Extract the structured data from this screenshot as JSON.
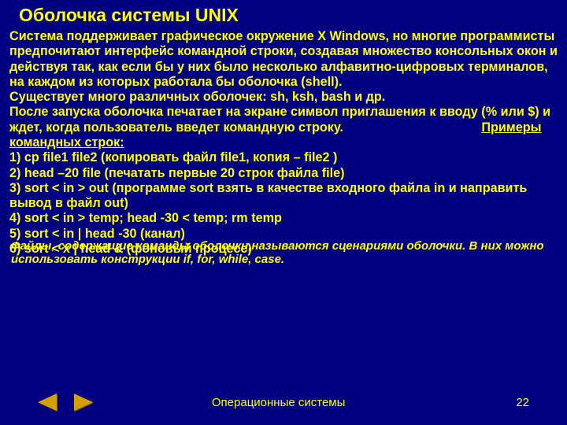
{
  "title": "Оболочка системы UNIX",
  "para1": "Система поддерживает графическое окружение X Windows, но многие программисты предпочитают интерфейс командной строки, создавая множество консольных окон и действуя так, как если бы у них было несколько алфавитно-цифровых терминалов, на каждом из которых работала бы  оболочка (shell).",
  "para2": "Существует много различных оболочек: sh, ksh, bash и др.",
  "para3": "После запуска оболочка печатает на экране символ приглашения к вводу  (%  или  $) и ждет, когда пользователь введет командную строку.",
  "examples_label": "Примеры командных строк",
  "colon": ":",
  "ex1": "1)   cp  file1 file2   (копировать файл file1, копия – file2 )",
  "ex2": "2)   head –20  file  (печатать первые 20 строк файла file)",
  "ex3": "3)   sort  <  in  >  out  (программе sort взять в качестве входного файла in и направить вывод в файл out)",
  "ex4": "4)  sort  <  in  > temp;  head  -30  < temp;  rm  temp",
  "ex5": "5)  sort  <  in  |  head  -30   (канал)",
  "ex6": "6)  sort  <  x  |   head  &   (фоновый процесс)",
  "note": "Файлы, содержащие команды оболочки,называются сценариями оболочки. В них можно использовать конструкции if, for, while, case.",
  "footer_title": "Операционные системы",
  "page_number": "22"
}
